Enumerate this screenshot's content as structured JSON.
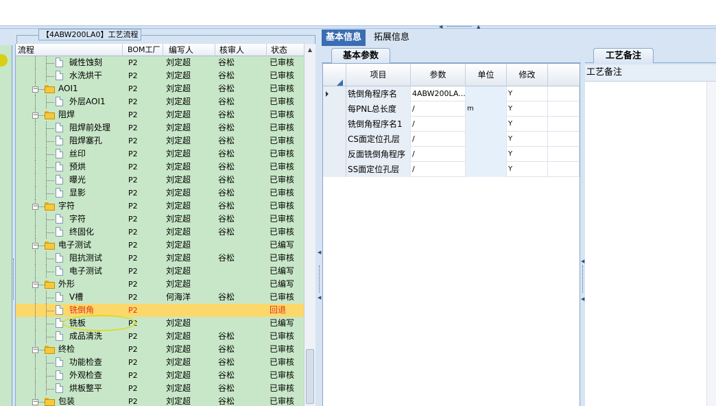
{
  "window": {
    "group_title": "【4ABW200LA0】工艺流程"
  },
  "tree": {
    "columns": [
      "流程",
      "BOM工厂",
      "编写人",
      "核审人",
      "状态"
    ],
    "rows": [
      {
        "level": 2,
        "type": "doc",
        "name": "碱性蚀刻",
        "bom": "P2",
        "writer": "刘定超",
        "reviewer": "谷松",
        "status": "已审核"
      },
      {
        "level": 2,
        "type": "doc",
        "name": "水洗烘干",
        "bom": "P2",
        "writer": "刘定超",
        "reviewer": "谷松",
        "status": "已审核"
      },
      {
        "level": 1,
        "type": "folder",
        "name": "AOI1",
        "bom": "P2",
        "writer": "刘定超",
        "reviewer": "谷松",
        "status": "已审核"
      },
      {
        "level": 2,
        "type": "doc",
        "name": "外层AOI1",
        "bom": "P2",
        "writer": "刘定超",
        "reviewer": "谷松",
        "status": "已审核"
      },
      {
        "level": 1,
        "type": "folder",
        "name": "阻焊",
        "bom": "P2",
        "writer": "刘定超",
        "reviewer": "谷松",
        "status": "已审核"
      },
      {
        "level": 2,
        "type": "doc",
        "name": "阻焊前处理",
        "bom": "P2",
        "writer": "刘定超",
        "reviewer": "谷松",
        "status": "已审核"
      },
      {
        "level": 2,
        "type": "doc",
        "name": "阻焊塞孔",
        "bom": "P2",
        "writer": "刘定超",
        "reviewer": "谷松",
        "status": "已审核"
      },
      {
        "level": 2,
        "type": "doc",
        "name": "丝印",
        "bom": "P2",
        "writer": "刘定超",
        "reviewer": "谷松",
        "status": "已审核"
      },
      {
        "level": 2,
        "type": "doc",
        "name": "预烘",
        "bom": "P2",
        "writer": "刘定超",
        "reviewer": "谷松",
        "status": "已审核"
      },
      {
        "level": 2,
        "type": "doc",
        "name": "曝光",
        "bom": "P2",
        "writer": "刘定超",
        "reviewer": "谷松",
        "status": "已审核"
      },
      {
        "level": 2,
        "type": "doc",
        "name": "显影",
        "bom": "P2",
        "writer": "刘定超",
        "reviewer": "谷松",
        "status": "已审核"
      },
      {
        "level": 1,
        "type": "folder",
        "name": "字符",
        "bom": "P2",
        "writer": "刘定超",
        "reviewer": "谷松",
        "status": "已审核"
      },
      {
        "level": 2,
        "type": "doc",
        "name": "字符",
        "bom": "P2",
        "writer": "刘定超",
        "reviewer": "谷松",
        "status": "已审核"
      },
      {
        "level": 2,
        "type": "doc",
        "name": "终固化",
        "bom": "P2",
        "writer": "刘定超",
        "reviewer": "谷松",
        "status": "已审核"
      },
      {
        "level": 1,
        "type": "folder",
        "name": "电子测试",
        "bom": "P2",
        "writer": "刘定超",
        "reviewer": "",
        "status": "已编写"
      },
      {
        "level": 2,
        "type": "doc",
        "name": "阻抗测试",
        "bom": "P2",
        "writer": "刘定超",
        "reviewer": "谷松",
        "status": "已审核"
      },
      {
        "level": 2,
        "type": "doc",
        "name": "电子测试",
        "bom": "P2",
        "writer": "刘定超",
        "reviewer": "",
        "status": "已编写"
      },
      {
        "level": 1,
        "type": "folder",
        "name": "外形",
        "bom": "P2",
        "writer": "刘定超",
        "reviewer": "",
        "status": "已编写"
      },
      {
        "level": 2,
        "type": "doc",
        "name": "V槽",
        "bom": "P2",
        "writer": "何海洋",
        "reviewer": "谷松",
        "status": "已审核"
      },
      {
        "level": 2,
        "type": "doc",
        "name": "铣倒角",
        "bom": "P2",
        "writer": "",
        "reviewer": "",
        "status": "回退",
        "selected": true
      },
      {
        "level": 2,
        "type": "doc",
        "name": "铣板",
        "bom": "P2",
        "writer": "刘定超",
        "reviewer": "",
        "status": "已编写"
      },
      {
        "level": 2,
        "type": "doc",
        "name": "成品清洗",
        "bom": "P2",
        "writer": "刘定超",
        "reviewer": "谷松",
        "status": "已审核"
      },
      {
        "level": 1,
        "type": "folder",
        "name": "终检",
        "bom": "P2",
        "writer": "刘定超",
        "reviewer": "谷松",
        "status": "已审核"
      },
      {
        "level": 2,
        "type": "doc",
        "name": "功能检查",
        "bom": "P2",
        "writer": "刘定超",
        "reviewer": "谷松",
        "status": "已审核"
      },
      {
        "level": 2,
        "type": "doc",
        "name": "外观检查",
        "bom": "P2",
        "writer": "刘定超",
        "reviewer": "谷松",
        "status": "已审核"
      },
      {
        "level": 2,
        "type": "doc",
        "name": "烘板整平",
        "bom": "P2",
        "writer": "刘定超",
        "reviewer": "谷松",
        "status": "已审核"
      },
      {
        "level": 1,
        "type": "folder",
        "name": "包装",
        "bom": "P2",
        "writer": "刘定超",
        "reviewer": "谷松",
        "status": "已审核"
      }
    ]
  },
  "detail": {
    "tabs": [
      "基本信息",
      "拓展信息"
    ],
    "active_tab": "基本信息",
    "subtab": "基本参数",
    "grid_columns": [
      "项目",
      "参数",
      "单位",
      "修改"
    ],
    "grid_rows": [
      {
        "item": "铣倒角程序名",
        "param": "4ABW200LA...",
        "unit": "",
        "modify": "Y",
        "current": true
      },
      {
        "item": "每PNL总长度",
        "param": "/",
        "unit": "m",
        "modify": "Y"
      },
      {
        "item": "铣倒角程序名1",
        "param": "/",
        "unit": "",
        "modify": "Y"
      },
      {
        "item": "CS面定位孔层",
        "param": "/",
        "unit": "",
        "modify": "Y"
      },
      {
        "item": "反面铣倒角程序",
        "param": "/",
        "unit": "",
        "modify": "Y"
      },
      {
        "item": "SS面定位孔层",
        "param": "/",
        "unit": "",
        "modify": "Y"
      }
    ]
  },
  "notes": {
    "tab": "工艺备注",
    "label": "工艺备注"
  },
  "colors": {
    "tree_bg": "#c8e7c8",
    "selected_row": "#fcd86a",
    "selected_text": "#e0301a",
    "active_tab": "#3a6db3",
    "chrome": "#d6e4f3"
  },
  "icons": {
    "folder": "folder-icon",
    "doc": "document-icon",
    "expander": "collapse-icon"
  }
}
